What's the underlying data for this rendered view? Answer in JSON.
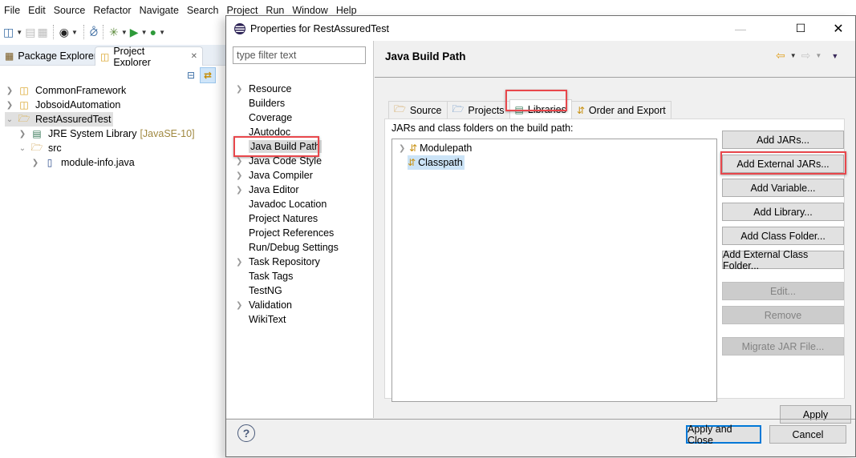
{
  "menubar": {
    "items": [
      "File",
      "Edit",
      "Source",
      "Refactor",
      "Navigate",
      "Search",
      "Project",
      "Run",
      "Window",
      "Help"
    ]
  },
  "toolbar": {
    "icons": [
      "new-wizard-icon",
      "save-icon",
      "save-all-icon",
      "profile-icon",
      "skip-breakpoints-icon",
      "debug-icon",
      "run-icon",
      "run-coverage-icon"
    ]
  },
  "view_tabs": {
    "package_explorer": "Package Explorer",
    "project_explorer": "Project Explorer"
  },
  "project_tree": [
    {
      "label": "CommonFramework",
      "expanded": false,
      "icon": "maven-project-warning-icon"
    },
    {
      "label": "JobsoidAutomation",
      "expanded": false,
      "icon": "maven-project-warning-icon"
    },
    {
      "label": "RestAssuredTest",
      "expanded": true,
      "selected": true,
      "icon": "project-folder-icon"
    },
    {
      "label": "JRE System Library",
      "decoration": "[JavaSE-10]",
      "expanded": false,
      "icon": "library-icon"
    },
    {
      "label": "src",
      "expanded": true,
      "icon": "source-folder-icon"
    },
    {
      "label": "module-info.java",
      "expanded": false,
      "icon": "java-file-icon"
    }
  ],
  "dialog": {
    "title": "Properties for RestAssuredTest",
    "filter_placeholder": "type filter text",
    "nav_items": [
      {
        "label": "Resource",
        "has_children": true
      },
      {
        "label": "Builders",
        "has_children": false
      },
      {
        "label": "Coverage",
        "has_children": false
      },
      {
        "label": "JAutodoc",
        "has_children": false
      },
      {
        "label": "Java Build Path",
        "has_children": false,
        "selected": true
      },
      {
        "label": "Java Code Style",
        "has_children": true
      },
      {
        "label": "Java Compiler",
        "has_children": true
      },
      {
        "label": "Java Editor",
        "has_children": true
      },
      {
        "label": "Javadoc Location",
        "has_children": false
      },
      {
        "label": "Project Natures",
        "has_children": false
      },
      {
        "label": "Project References",
        "has_children": false
      },
      {
        "label": "Run/Debug Settings",
        "has_children": false
      },
      {
        "label": "Task Repository",
        "has_children": true
      },
      {
        "label": "Task Tags",
        "has_children": false
      },
      {
        "label": "TestNG",
        "has_children": false
      },
      {
        "label": "Validation",
        "has_children": true
      },
      {
        "label": "WikiText",
        "has_children": false
      }
    ],
    "page_title": "Java Build Path",
    "tabs": [
      {
        "label": "Source",
        "icon": "source-folder-icon"
      },
      {
        "label": "Projects",
        "icon": "projects-folder-icon"
      },
      {
        "label": "Libraries",
        "icon": "libraries-icon",
        "active": true
      },
      {
        "label": "Order and Export",
        "icon": "order-export-icon"
      }
    ],
    "libraries_caption": "JARs and class folders on the build path:",
    "classpath_entries": [
      {
        "label": "Modulepath",
        "expandable": true
      },
      {
        "label": "Classpath",
        "expandable": false,
        "selected": true
      }
    ],
    "side_buttons": [
      {
        "label": "Add JARs...",
        "enabled": true
      },
      {
        "label": "Add External JARs...",
        "enabled": true,
        "highlighted": true
      },
      {
        "label": "Add Variable...",
        "enabled": true
      },
      {
        "label": "Add Library...",
        "enabled": true
      },
      {
        "label": "Add Class Folder...",
        "enabled": true
      },
      {
        "label": "Add External Class Folder...",
        "enabled": true
      },
      {
        "label": "Edit...",
        "enabled": false
      },
      {
        "label": "Remove",
        "enabled": false
      },
      {
        "label": "Migrate JAR File...",
        "enabled": false
      }
    ],
    "apply_label": "Apply",
    "apply_close_label": "Apply and Close",
    "cancel_label": "Cancel",
    "help_symbol": "?"
  },
  "highlight_color": "#e8474c",
  "accent_color": "#0078d7"
}
